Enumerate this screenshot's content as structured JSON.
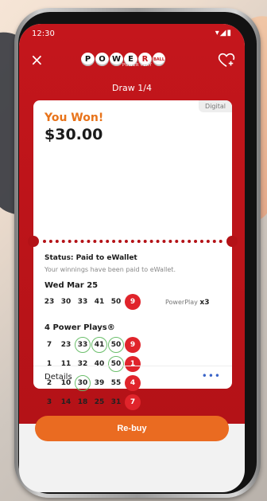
{
  "status_bar": {
    "time": "12:30",
    "icons": "▾◢▮"
  },
  "nav": {
    "close_icon": "×",
    "logo_letters": [
      "P",
      "O",
      "W",
      "E",
      "R"
    ],
    "logo_ball_text": "BALL",
    "logo_sub": "POWER PLAY"
  },
  "draw_label": "Draw 1/4",
  "ticket": {
    "badge": "Digital",
    "headline": "You Won!",
    "amount": "$30.00",
    "status": "Status: Paid to eWallet",
    "status_desc": "Your winnings have been paid to eWallet.",
    "draw_date": "Wed Mar 25",
    "winning_numbers": [
      "23",
      "30",
      "33",
      "41",
      "50"
    ],
    "winning_powerball": "9",
    "powerplay_label": "PowerPlay",
    "powerplay_value": "x3",
    "plays_title": "4 Power Plays®",
    "plays": [
      {
        "numbers": [
          "7",
          "23",
          "33",
          "41",
          "50"
        ],
        "matched": [
          false,
          false,
          true,
          true,
          true
        ],
        "powerball": "9",
        "pb_match": true
      },
      {
        "numbers": [
          "1",
          "11",
          "32",
          "40",
          "50"
        ],
        "matched": [
          false,
          false,
          false,
          false,
          true
        ],
        "powerball": "1",
        "pb_match": false
      },
      {
        "numbers": [
          "2",
          "10",
          "30",
          "39",
          "55"
        ],
        "matched": [
          false,
          false,
          true,
          false,
          false
        ],
        "powerball": "4",
        "pb_match": false
      },
      {
        "numbers": [
          "3",
          "14",
          "18",
          "25",
          "31"
        ],
        "matched": [
          false,
          false,
          false,
          false,
          false
        ],
        "powerball": "7",
        "pb_match": false
      }
    ],
    "details_label": "Details",
    "more_label": "•••"
  },
  "rebuy_label": "Re-buy",
  "colors": {
    "brand_red": "#c4161c",
    "accent_orange": "#ea6b21",
    "win_orange": "#e8731a",
    "match_green": "#6dbf6d"
  }
}
